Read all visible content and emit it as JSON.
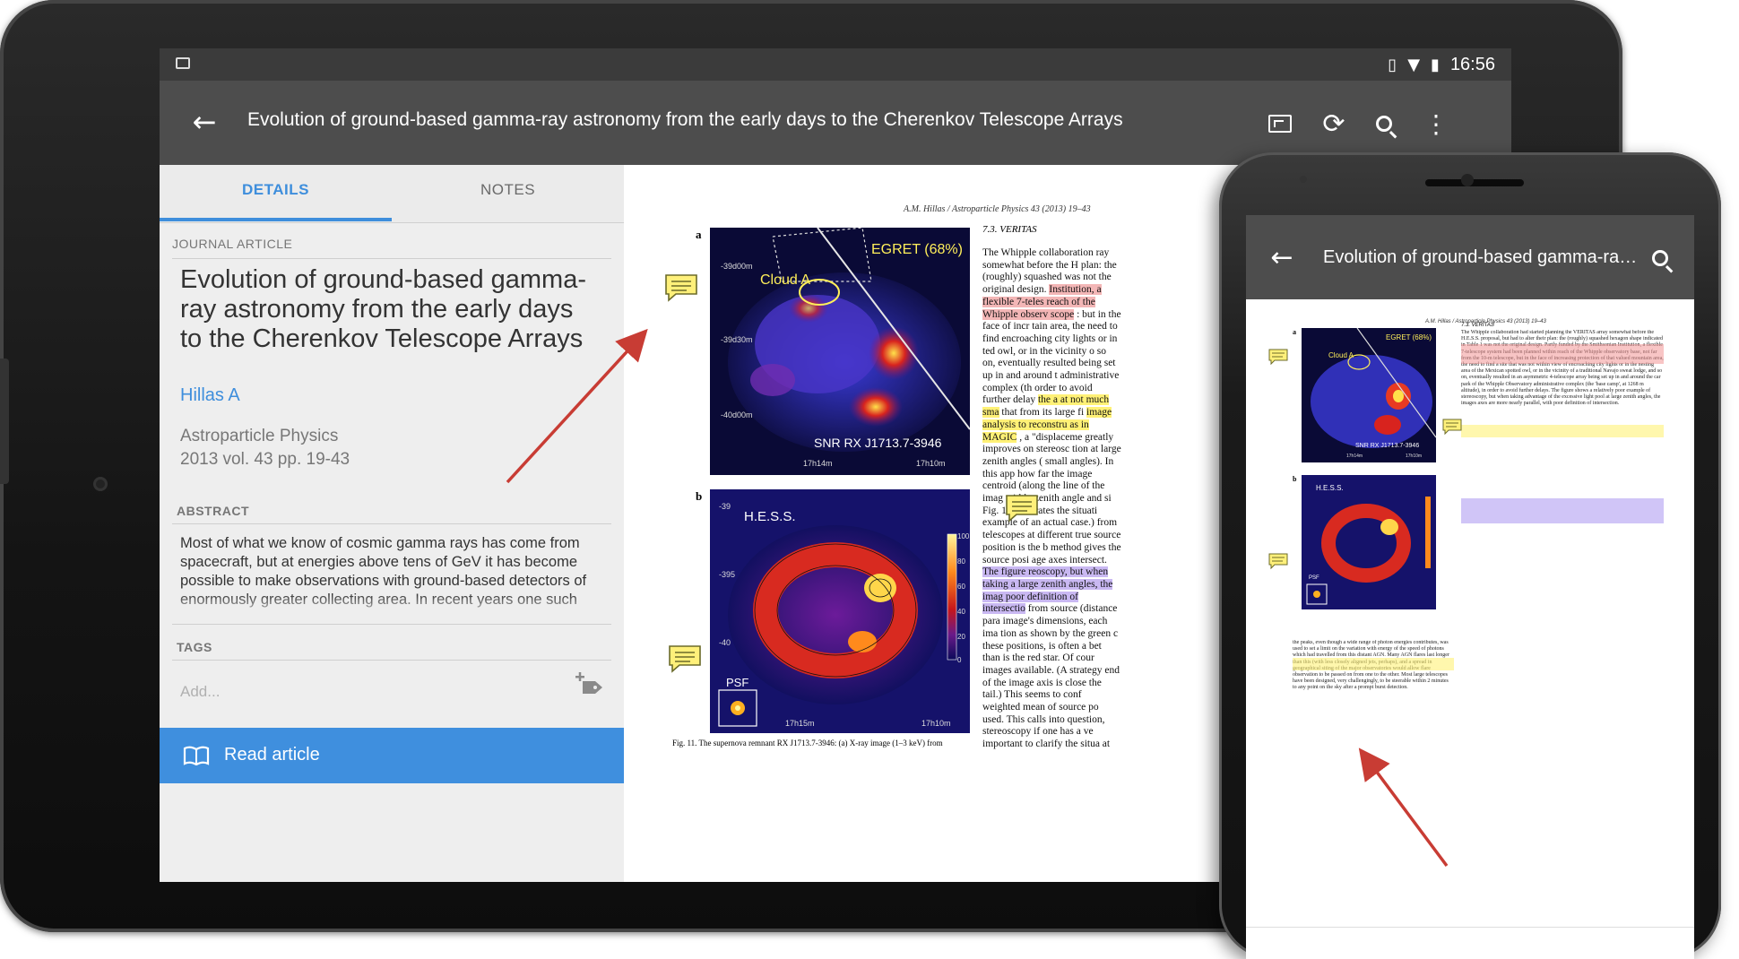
{
  "status_bar": {
    "time": "16:56"
  },
  "app_bar": {
    "title": "Evolution of ground-based gamma-ray astronomy from the early days to the Cherenkov Telescope Arrays"
  },
  "tabs": [
    {
      "label": "DETAILS"
    },
    {
      "label": "NOTES"
    }
  ],
  "details": {
    "type_label": "JOURNAL ARTICLE",
    "title": "Evolution of ground-based gamma-ray astronomy from the early days to the Cherenkov Telescope Arrays",
    "author": "Hillas A",
    "journal": "Astroparticle Physics",
    "volume_info": "2013 vol. 43 pp. 19-43",
    "abstract_label": "ABSTRACT",
    "abstract": "Most of what we know of cosmic gamma rays has come from spacecraft, but at energies above tens of GeV it has become possible to make observations with ground-based detectors of enormously greater collecting area. In recent years one such",
    "tags_label": "TAGS",
    "tags_placeholder": "Add...",
    "read_button": "Read article"
  },
  "page": {
    "running_head": "A.M. Hillas / Astroparticle Physics 43 (2013) 19–43",
    "section_heading": "7.3. VERITAS",
    "panel_a": {
      "letter": "a",
      "label_egret": "EGRET (68%)",
      "label_cloud": "Cloud A",
      "label_snr": "SNR RX J1713.7-3946",
      "y_ticks": [
        "-39d00m",
        "-39d30m",
        "-40d00m"
      ],
      "x_ticks": [
        "17h14m",
        "17h10m"
      ]
    },
    "panel_b": {
      "letter": "b",
      "label_hess": "H.E.S.S.",
      "label_psf": "PSF",
      "y_ticks": [
        "-39",
        "-395",
        "-40"
      ],
      "x_ticks": [
        "17h15m",
        "17h10m"
      ],
      "scale_ticks": [
        "100",
        "80",
        "60",
        "40",
        "20",
        "0"
      ]
    },
    "caption": "Fig. 11. The supernova remnant RX J1713.7-3946: (a) X-ray image (1–3 keV) from",
    "body_segments": [
      {
        "text": "The Whipple collaboration ray somewhat before the H plan: the (roughly) squashed was not the original design. ",
        "hl": ""
      },
      {
        "text": "Institution, a flexible 7-teles reach of the Whipple observ scope",
        "hl": "red"
      },
      {
        "text": ": but in the face of incr tain area, the need to find encroaching city lights or in ted owl, or in the vicinity o so on, eventually resulted being set up in and around t administrative complex (th order to avoid further delay ",
        "hl": ""
      },
      {
        "text": "the a at not much sma",
        "hl": "yellow"
      },
      {
        "text": " that from its large fi ",
        "hl": ""
      },
      {
        "text": "image analysis to reconstru as in MAGIC",
        "hl": "yellow"
      },
      {
        "text": ", a \"displaceme greatly improves on stereosc tion at large zenith angles ( small angles). In this app how far the image centroid (along the line of the imag width, zenith angle and si Fig. 14 illustrates the situati example of an actual case.) from telescopes at different true source position is the b method gives the source posi age axes intersect. ",
        "hl": ""
      },
      {
        "text": "The figure reoscopy, but when taking a large zenith angles, the imag poor definition of intersectio",
        "hl": "purple"
      },
      {
        "text": " from source (distance para image's dimensions, each ima tion as shown by the green c these positions, is often a bet than is the red star. Of cour images available. (A strategy end of the image axis is close the tail.) This seems to conf weighted mean of source po used. This calls into question, stereoscopy if one has a ve important to clarify the situa at low energies, for example of many telescopes should b",
        "hl": ""
      }
    ]
  },
  "phone": {
    "title": "Evolution of ground-based gamma-ray astronomy from the early days to the Cherenkov Telescope Arrays",
    "running_head": "A.M. Hillas / Astroparticle Physics 43 (2013) 19–43",
    "section_heading": "7.3. VERITAS",
    "panel_a": {
      "letter": "a",
      "label_egret": "EGRET (68%)",
      "label_cloud": "Cloud A",
      "label_snr": "SNR RX J1713.7-3946",
      "x_ticks": [
        "17h14m",
        "17h10m"
      ]
    },
    "panel_b": {
      "letter": "b",
      "label_hess": "H.E.S.S.",
      "label_psf": "PSF"
    },
    "text_col": "The Whipple collaboration had started planning the VERITAS array somewhat before the H.E.S.S. proposal, but had to alter their plan: the (roughly) squashed hexagon shape indicated in Table 1 was not the original design. Partly funded by the Smithsonian Institution, a flexible 7-telescope system had been planned within reach of the Whipple observatory base, not far from the 10-m telescope, but in the face of increasing protection of that valued mountain area, the need to find a site that was not within view of encroaching city lights or in the nesting area of the Mexican spotted owl, or in the vicinity of a traditional Navajo sweat lodge, and so on, eventually resulted in an asymmetric 4-telescope array being set up in and around the car park of the Whipple Observatory administrative complex (the 'base camp', at 1268 m altitude), in order to avoid further delays. The figure shows a relatively poor example of stereoscopy, but when taking advantage of the excessive light pool at large zenith angles, the images axes are more nearly parallel, with poor definition of intersection.",
    "text_col2": "the peaks, even though a wide range of photon energies contributes, was used to set a limit on the variation with energy of the speed of photons which had travelled from this distant AGN. Many AGN flares last longer than this (with less closely aligned jets, perhaps), and a spread in geographical siting of the major observatories would allow flare observation to be passed on from one to the other. Most large telescopes have been designed, very challengingly, to be steerable within 2 minutes to any point on the sky after a prompt burst detection."
  },
  "colors": {
    "accent": "#3e8edc",
    "appbar": "#4d4d4d",
    "statusbar": "#3b3b3b",
    "button": "#3f8fde"
  }
}
